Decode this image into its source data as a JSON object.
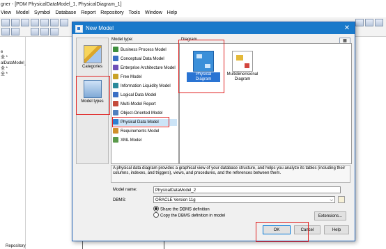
{
  "app": {
    "title": "gner - [PDM PhysicalDataModel_1, PhysicalDiagram_1]",
    "menu": [
      "View",
      "Model",
      "Symbol",
      "Database",
      "Report",
      "Repository",
      "Tools",
      "Window",
      "Help"
    ],
    "browser_nodes": [
      "e",
      "全 *",
      "alDataModel_1 *",
      "全 *",
      "全 *"
    ],
    "status_text": "Repository"
  },
  "dialog": {
    "title": "New Model",
    "close_glyph": "✕",
    "left_pane": {
      "categories_label": "Categories",
      "model_types_label": "Model types"
    },
    "model_type_label": "Model type:",
    "model_types": [
      {
        "label": "Business Process Model",
        "color": "#3e8f3e"
      },
      {
        "label": "Conceptual Data Model",
        "color": "#3a6fc4"
      },
      {
        "label": "Enterprise Architecture Model",
        "color": "#6d4fb8"
      },
      {
        "label": "Free Model",
        "color": "#c9a227"
      },
      {
        "label": "Information Liquidity Model",
        "color": "#2a8a9a"
      },
      {
        "label": "Logical Data Model",
        "color": "#3a6fc4"
      },
      {
        "label": "Multi-Model Report",
        "color": "#c44a3a"
      },
      {
        "label": "Object-Oriented Model",
        "color": "#4f7fbf"
      },
      {
        "label": "Physical Data Model",
        "color": "#2f7fd0"
      },
      {
        "label": "Requirements Model",
        "color": "#d08f2a"
      },
      {
        "label": "XML Model",
        "color": "#5a9a4a"
      }
    ],
    "selected_model_type": "Physical Data Model",
    "diagram_label": "Diagram",
    "diagrams": [
      {
        "label": "Physical Diagram",
        "selected": true
      },
      {
        "label": "Multidimensional Diagram",
        "selected": false
      }
    ],
    "description": "A physical data diagram provides a graphical view of your database structure, and helps you analyze its tables (including their columns, indexes, and triggers), views, and procedures, and the references between them.",
    "model_name_label": "Model name:",
    "model_name_value": "PhysicalDataModel_2",
    "dbms_label": "DBMS:",
    "dbms_value": "ORACLE Version 11g",
    "share_option": "Share the DBMS definition",
    "copy_option": "Copy the DBMS definition in model",
    "extensions_label": "Extensions...",
    "ok_label": "OK",
    "cancel_label": "Cancel",
    "help_label": "Help"
  }
}
